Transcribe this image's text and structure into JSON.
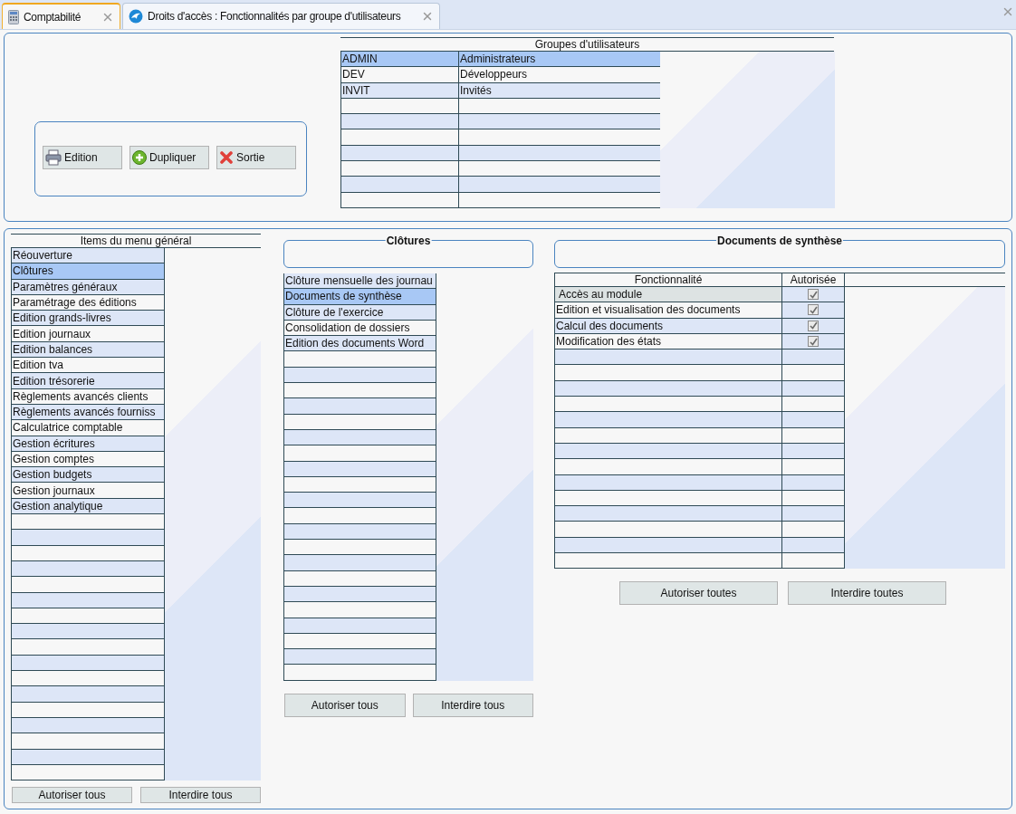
{
  "tabs": [
    {
      "label": "Comptabilité",
      "selected": true
    },
    {
      "label": "Droits d'accès : Fonctionnalités par groupe d'utilisateurs",
      "selected": false
    }
  ],
  "actions": [
    {
      "label": "Edition",
      "kind": "print"
    },
    {
      "label": "Dupliquer",
      "kind": "add"
    },
    {
      "label": "Sortie",
      "kind": "exit"
    }
  ],
  "groups": {
    "title": "Groupes d'utilisateurs",
    "rows": [
      {
        "code": "ADMIN",
        "name": "Administrateurs",
        "selected": true
      },
      {
        "code": "DEV",
        "name": "Développeurs",
        "selected": false
      },
      {
        "code": "INVIT",
        "name": "Invités",
        "selected": false
      }
    ]
  },
  "menu_items": {
    "title": "Items du menu général",
    "items": [
      {
        "label": "Réouverture",
        "selected": false
      },
      {
        "label": "Clôtures",
        "selected": true
      },
      {
        "label": "Paramètres généraux",
        "selected": false
      },
      {
        "label": "Paramétrage des éditions",
        "selected": false
      },
      {
        "label": "Edition grands-livres",
        "selected": false
      },
      {
        "label": "Edition journaux",
        "selected": false
      },
      {
        "label": "Edition balances",
        "selected": false
      },
      {
        "label": "Edition tva",
        "selected": false
      },
      {
        "label": "Edition trésorerie",
        "selected": false
      },
      {
        "label": "Règlements avancés clients",
        "selected": false
      },
      {
        "label": "Règlements avancés fourniss",
        "selected": false
      },
      {
        "label": "Calculatrice comptable",
        "selected": false
      },
      {
        "label": "Gestion écritures",
        "selected": false
      },
      {
        "label": "Gestion comptes",
        "selected": false
      },
      {
        "label": "Gestion budgets",
        "selected": false
      },
      {
        "label": "Gestion journaux",
        "selected": false
      },
      {
        "label": "Gestion analytique",
        "selected": false
      }
    ],
    "buttons": [
      "Autoriser tous",
      "Interdire tous"
    ]
  },
  "closures": {
    "title": "Clôtures",
    "items": [
      {
        "label": "Clôture mensuelle des journau",
        "selected": false
      },
      {
        "label": "Documents de synthèse",
        "selected": true
      },
      {
        "label": "Clôture de l'exercice",
        "selected": false
      },
      {
        "label": "Consolidation de dossiers",
        "selected": false
      },
      {
        "label": "Edition des documents Word",
        "selected": false
      }
    ],
    "buttons": [
      "Autoriser tous",
      "Interdire tous"
    ]
  },
  "documents": {
    "title": "Documents de synthèse",
    "columns": [
      "Fonctionnalité",
      "Autorisée"
    ],
    "rows": [
      {
        "label": "Accès au module",
        "allowed": true,
        "selected": true
      },
      {
        "label": "Edition et visualisation des documents",
        "allowed": true,
        "selected": false
      },
      {
        "label": "Calcul des documents",
        "allowed": true,
        "selected": false
      },
      {
        "label": "Modification des états",
        "allowed": true,
        "selected": false
      }
    ],
    "buttons": [
      "Autoriser toutes",
      "Interdire toutes"
    ]
  }
}
